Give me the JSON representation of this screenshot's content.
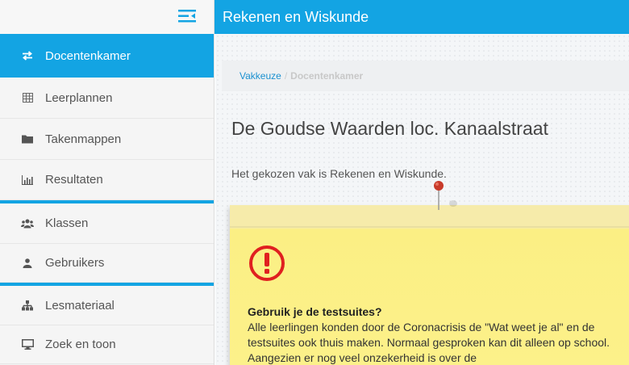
{
  "header": {
    "title": "Rekenen en Wiskunde"
  },
  "sidebar": {
    "items": [
      {
        "label": "Docentenkamer",
        "icon": "exchange-icon",
        "active": true
      },
      {
        "label": "Leerplannen",
        "icon": "table-icon"
      },
      {
        "label": "Takenmappen",
        "icon": "folder-icon"
      },
      {
        "label": "Resultaten",
        "icon": "bar-chart-icon"
      },
      {
        "label": "Klassen",
        "icon": "users-icon"
      },
      {
        "label": "Gebruikers",
        "icon": "user-icon"
      },
      {
        "label": "Lesmateriaal",
        "icon": "sitemap-icon"
      },
      {
        "label": "Zoek en toon",
        "icon": "desktop-icon"
      }
    ]
  },
  "breadcrumb": {
    "link": "Vakkeuze",
    "separator": "/",
    "current": "Docentenkamer"
  },
  "main": {
    "title": "De Goudse Waarden loc. Kanaalstraat",
    "intro": "Het gekozen vak is Rekenen en Wiskunde."
  },
  "note": {
    "title": "Gebruik je de testsuites?",
    "body": "Alle leerlingen konden door de Coronacrisis de \"Wat weet je al\" en de testsuites ook thuis maken. Normaal gesproken kan dit alleen op school. Aangezien er nog veel onzekerheid is over de"
  },
  "colors": {
    "accent": "#13a4e3",
    "note": "#fcf18a",
    "alert": "#e02020"
  }
}
